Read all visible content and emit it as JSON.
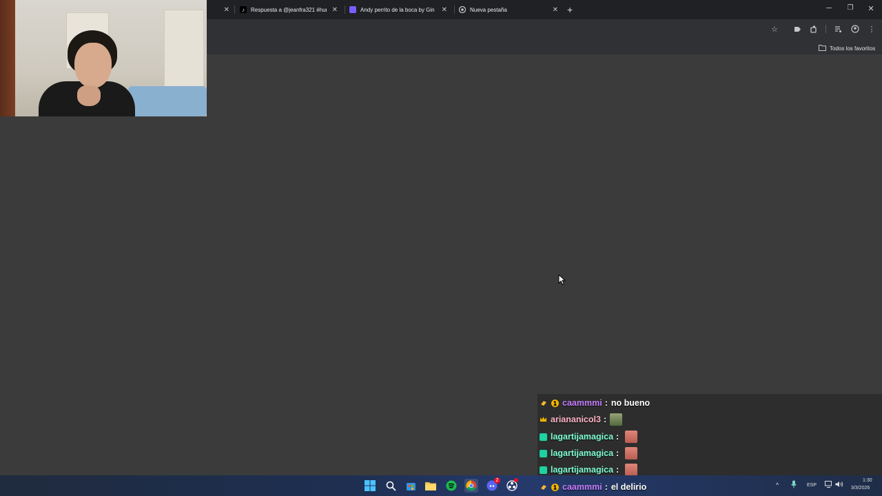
{
  "browser": {
    "tabs": [
      {
        "title": "Respuesta a @jeanfra321 #hum",
        "favicon": "tiktok-icon"
      },
      {
        "title": "Andy perrito de la boca by Gin",
        "favicon": "app-icon"
      },
      {
        "title": "Nueva pestaña",
        "favicon": "chrome-icon"
      }
    ],
    "new_tab": "+",
    "close": "✕",
    "bookmarks_label": "Todos los favoritos"
  },
  "chat": {
    "messages": [
      {
        "user": "caammmi",
        "text": "no bueno",
        "user_color": "#c77dff",
        "badges": [
          "bits-icon",
          "gold-one-icon"
        ]
      },
      {
        "user": "ariananicol3",
        "text": "",
        "user_color": "#ffb3c6",
        "badges": [
          "crown-icon"
        ],
        "emote": "portrait-emote"
      },
      {
        "user": "lagartijamagica",
        "text": "",
        "user_color": "#7fffd4",
        "badges": [
          "sub-icon"
        ],
        "emote": "thumb-emote"
      },
      {
        "user": "lagartijamagica",
        "text": "",
        "user_color": "#7fffd4",
        "badges": [
          "sub-icon"
        ],
        "emote": "thumb-emote"
      },
      {
        "user": "lagartijamagica",
        "text": "",
        "user_color": "#7fffd4",
        "badges": [
          "sub-icon"
        ],
        "emote": "thumb-emote"
      },
      {
        "user": "caammmi",
        "text": "el delirio",
        "user_color": "#c77dff",
        "badges": [
          "bits-icon",
          "gold-one-icon"
        ]
      }
    ]
  },
  "taskbar": {
    "lang": "ESP",
    "time": "1:30",
    "date": "3/3/2026",
    "discord_badge": "2"
  },
  "colors": {
    "page_bg": "#3b3b3b",
    "tabbar_bg": "#202124",
    "toolbar_bg": "#303134"
  }
}
